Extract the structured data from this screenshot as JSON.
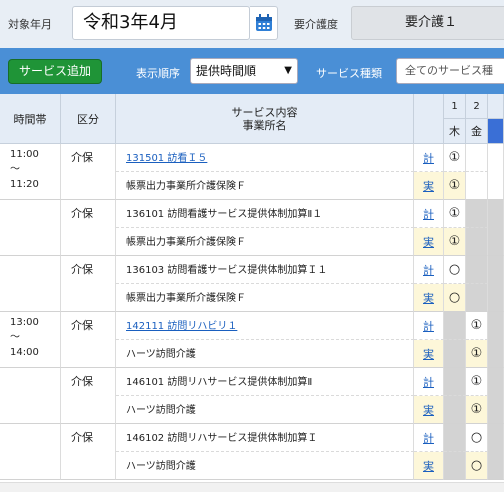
{
  "header": {
    "target_month_label": "対象年月",
    "target_month_value": "令和3年4月",
    "care_level_label": "要介護度",
    "care_level_value": "要介護１"
  },
  "filters": {
    "add_service_label": "サービス追加",
    "order_label": "表示順序",
    "order_value": "提供時間順",
    "service_type_label": "サービス種類",
    "service_type_value": "全てのサービス種"
  },
  "table": {
    "col_time": "時間帯",
    "col_kubun": "区分",
    "col_service_line1": "サービス内容",
    "col_service_line2": "事業所名",
    "days": [
      {
        "num": "1",
        "dow": "木"
      },
      {
        "num": "2",
        "dow": "金"
      }
    ],
    "rows": [
      {
        "time_start": "11:00",
        "time_sep": "〜",
        "time_end": "11:20",
        "kubun": "介保",
        "service": "131501 訪看Ｉ５",
        "service_link": true,
        "office": "帳票出力事業所介護保険Ｆ",
        "kei": "計",
        "jitsu": "実",
        "plan_marks": [
          "①",
          ""
        ],
        "actual_marks": [
          "①",
          ""
        ]
      },
      {
        "time_start": "",
        "time_sep": "",
        "time_end": "",
        "kubun": "介保",
        "service": "136101 訪問看護サービス提供体制加算Ⅱ１",
        "service_link": false,
        "office": "帳票出力事業所介護保険Ｆ",
        "kei": "計",
        "jitsu": "実",
        "plan_marks": [
          "①",
          ""
        ],
        "actual_marks": [
          "①",
          ""
        ]
      },
      {
        "time_start": "",
        "time_sep": "",
        "time_end": "",
        "kubun": "介保",
        "service": "136103 訪問看護サービス提供体制加算Ｉ１",
        "service_link": false,
        "office": "帳票出力事業所介護保険Ｆ",
        "kei": "計",
        "jitsu": "実",
        "plan_marks": [
          "○",
          ""
        ],
        "actual_marks": [
          "○",
          ""
        ]
      },
      {
        "time_start": "13:00",
        "time_sep": "〜",
        "time_end": "14:00",
        "kubun": "介保",
        "service": "142111 訪問リハビリ１",
        "service_link": true,
        "office": "ハーツ訪問介護",
        "kei": "計",
        "jitsu": "実",
        "plan_marks": [
          "",
          "①"
        ],
        "actual_marks": [
          "",
          "①"
        ]
      },
      {
        "time_start": "",
        "time_sep": "",
        "time_end": "",
        "kubun": "介保",
        "service": "146101 訪問リハサービス提供体制加算Ⅱ",
        "service_link": false,
        "office": "ハーツ訪問介護",
        "kei": "計",
        "jitsu": "実",
        "plan_marks": [
          "",
          "①"
        ],
        "actual_marks": [
          "",
          "①"
        ]
      },
      {
        "time_start": "",
        "time_sep": "",
        "time_end": "",
        "kubun": "介保",
        "service": "146102 訪問リハサービス提供体制加算Ｉ",
        "service_link": false,
        "office": "ハーツ訪問介護",
        "kei": "計",
        "jitsu": "実",
        "plan_marks": [
          "",
          "○"
        ],
        "actual_marks": [
          "",
          "○"
        ]
      }
    ]
  }
}
